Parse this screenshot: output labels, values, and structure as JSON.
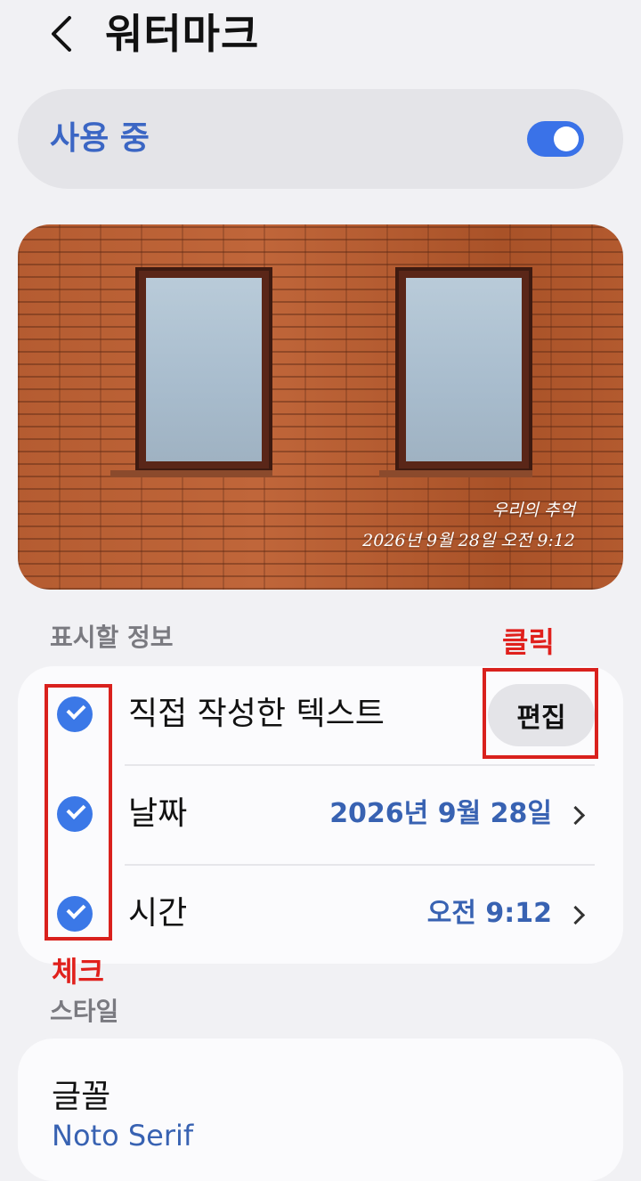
{
  "header": {
    "title": "워터마크"
  },
  "toggle": {
    "label": "사용 중",
    "enabled": true,
    "accent_color": "#3a72e8"
  },
  "preview": {
    "watermark_lines": [
      "우리의 추억",
      "2026년 9월 28일 오전 9:12"
    ]
  },
  "info_section": {
    "title": "표시할 정보",
    "items": [
      {
        "label": "직접 작성한 텍스트",
        "checked": true,
        "action_label": "편집"
      },
      {
        "label": "날짜",
        "checked": true,
        "value": "2026년 9월 28일"
      },
      {
        "label": "시간",
        "checked": true,
        "value": "오전 9:12"
      }
    ]
  },
  "style_section": {
    "title": "스타일",
    "font_label": "글꼴",
    "font_value": "Noto Serif"
  },
  "annotations": {
    "click_label": "클릭",
    "check_label": "체크",
    "color": "#e0201c"
  }
}
